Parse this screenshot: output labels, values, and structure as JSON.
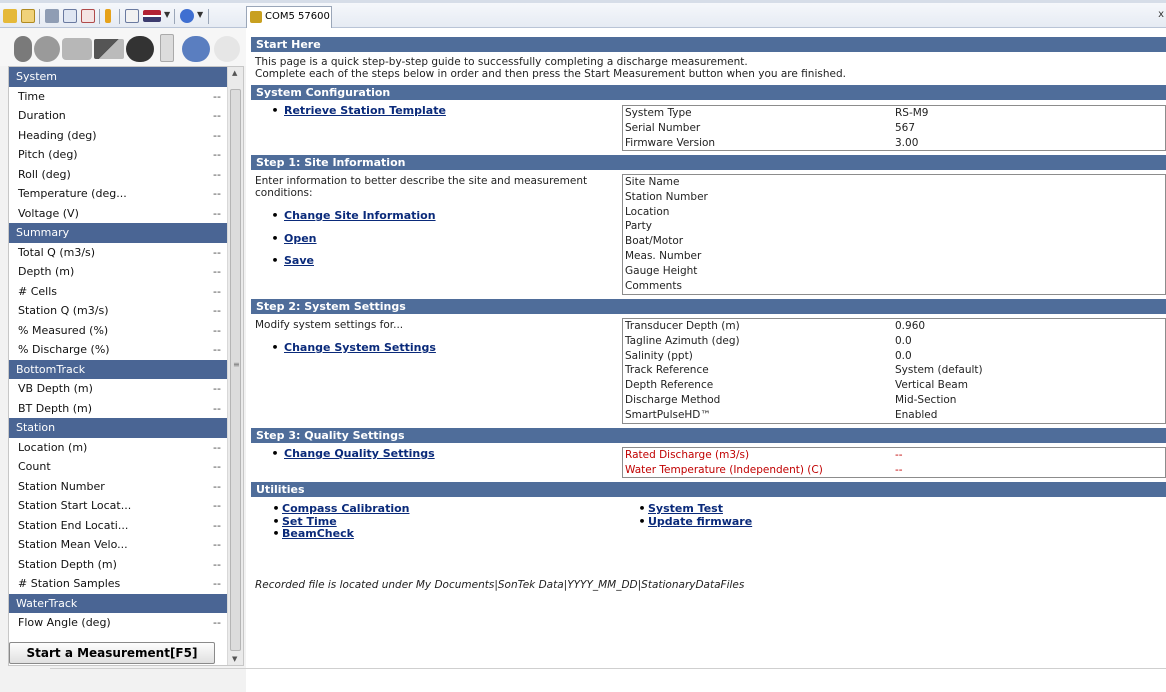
{
  "toolbar": {
    "com_tab_label": "COM5 57600",
    "close_glyph": "x",
    "icons": [
      "open-folder-icon",
      "folder-icon",
      "tools-icon",
      "document-icon",
      "checklist-icon",
      "warning-icon",
      "edit-icon",
      "flag-icon",
      "help-icon",
      "device-icon"
    ]
  },
  "left_panel": {
    "sections": [
      {
        "title": "System",
        "rows": [
          {
            "label": "Time",
            "value": "--"
          },
          {
            "label": "Duration",
            "value": "--"
          },
          {
            "label": "Heading (deg)",
            "value": "--"
          },
          {
            "label": "Pitch (deg)",
            "value": "--"
          },
          {
            "label": "Roll (deg)",
            "value": "--"
          },
          {
            "label": "Temperature (deg...",
            "value": "--"
          },
          {
            "label": "Voltage (V)",
            "value": "--"
          }
        ]
      },
      {
        "title": "Summary",
        "rows": [
          {
            "label": "Total Q (m3/s)",
            "value": "--"
          },
          {
            "label": "Depth (m)",
            "value": "--"
          },
          {
            "label": "# Cells",
            "value": "--"
          },
          {
            "label": "Station Q (m3/s)",
            "value": "--"
          },
          {
            "label": "% Measured (%)",
            "value": "--"
          },
          {
            "label": "% Discharge (%)",
            "value": "--"
          }
        ]
      },
      {
        "title": "BottomTrack",
        "rows": [
          {
            "label": "VB Depth (m)",
            "value": "--"
          },
          {
            "label": "BT Depth (m)",
            "value": "--"
          }
        ]
      },
      {
        "title": "Station",
        "rows": [
          {
            "label": "Location (m)",
            "value": "--"
          },
          {
            "label": "Count",
            "value": "--"
          },
          {
            "label": "Station Number",
            "value": "--"
          },
          {
            "label": "Station Start Locat...",
            "value": "--"
          },
          {
            "label": "Station End Locati...",
            "value": "--"
          },
          {
            "label": "Station Mean Velo...",
            "value": "--"
          },
          {
            "label": "Station Depth (m)",
            "value": "--"
          },
          {
            "label": "# Station Samples",
            "value": "--"
          }
        ]
      },
      {
        "title": "WaterTrack",
        "rows": [
          {
            "label": "Flow Angle (deg)",
            "value": "--"
          }
        ]
      }
    ],
    "start_button": "Start a Measurement[F5]",
    "grip_glyph": "≡",
    "scroll_up": "▲",
    "scroll_down": "▼"
  },
  "main": {
    "start_here": {
      "title": "Start Here",
      "line1": "This page is a quick step-by-step guide to successfully completing a discharge measurement.",
      "line2": "Complete each of the steps below in order and then press the Start Measurement button when you are finished."
    },
    "system_configuration": {
      "title": "System Configuration",
      "link": "Retrieve Station Template",
      "info": [
        {
          "label": "System Type",
          "value": "RS-M9"
        },
        {
          "label": "Serial Number",
          "value": "567"
        },
        {
          "label": "Firmware Version",
          "value": "3.00"
        }
      ]
    },
    "step1": {
      "title": "Step 1:  Site Information",
      "desc1": "Enter information to better describe the site and measurement",
      "desc2": "conditions:",
      "links": [
        "Change Site Information",
        "Open",
        "Save"
      ],
      "info": [
        {
          "label": "Site Name"
        },
        {
          "label": "Station Number"
        },
        {
          "label": "Location"
        },
        {
          "label": "Party"
        },
        {
          "label": "Boat/Motor"
        },
        {
          "label": "Meas. Number"
        },
        {
          "label": "Gauge Height"
        },
        {
          "label": "Comments"
        }
      ]
    },
    "step2": {
      "title": "Step 2:  System Settings",
      "desc": "Modify system settings for...",
      "link": "Change System Settings",
      "info": [
        {
          "label": "Transducer Depth (m)",
          "value": "0.960"
        },
        {
          "label": "Tagline Azimuth (deg)",
          "value": "0.0"
        },
        {
          "label": "Salinity (ppt)",
          "value": "0.0"
        },
        {
          "label": "Track Reference",
          "value": "System (default)"
        },
        {
          "label": "Depth Reference",
          "value": "Vertical Beam"
        },
        {
          "label": "Discharge Method",
          "value": "Mid-Section"
        },
        {
          "label": "SmartPulseHD™",
          "value": "Enabled"
        }
      ]
    },
    "step3": {
      "title": "Step 3:  Quality Settings",
      "link": "Change Quality Settings",
      "info": [
        {
          "label": "Rated Discharge (m3/s)",
          "value": "--"
        },
        {
          "label": "Water Temperature (Independent) (C)",
          "value": "--"
        }
      ]
    },
    "utilities": {
      "title": "Utilities",
      "left_links": [
        "Compass Calibration",
        "Set Time",
        "BeamCheck"
      ],
      "right_links": [
        "System Test",
        "Update firmware"
      ]
    },
    "footer_note": "Recorded file is located under My Documents|SonTek Data|YYYY_MM_DD|StationaryDataFiles",
    "bullet": "•",
    "colors": {
      "header_blue": "#4f6d9a",
      "left_header_blue": "#4a6594",
      "warning_red": "#c00000",
      "link_blue": "#0a2a7a"
    }
  }
}
